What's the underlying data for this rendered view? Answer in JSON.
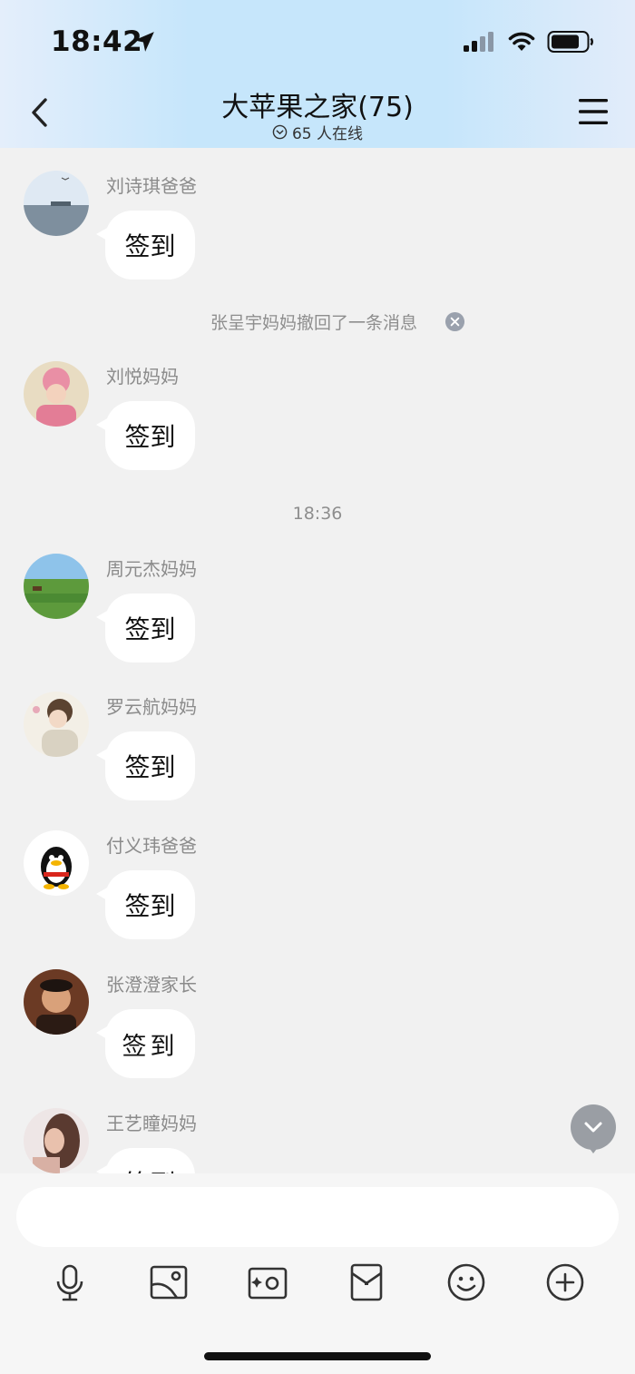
{
  "status_bar": {
    "time": "18:42"
  },
  "header": {
    "title": "大苹果之家(75)",
    "online": "65 人在线"
  },
  "messages": [
    {
      "sender": "刘诗琪爸爸",
      "text": "签到"
    },
    {
      "sender": "刘悦妈妈",
      "text": "签到"
    },
    {
      "sender": "周元杰妈妈",
      "text": "签到"
    },
    {
      "sender": "罗云航妈妈",
      "text": "签到"
    },
    {
      "sender": "付义玮爸爸",
      "text": "签到"
    },
    {
      "sender": "张澄澄家长",
      "text": "签到"
    },
    {
      "sender": "王艺瞳妈妈",
      "text": "签到"
    }
  ],
  "system": {
    "recall_notice": "张呈宇妈妈撤回了一条消息",
    "timestamp": "18:36"
  },
  "input": {
    "placeholder": ""
  },
  "toolbar": [
    "microphone-icon",
    "image-icon",
    "camera-icon",
    "red-packet-icon",
    "emoji-icon",
    "plus-icon"
  ],
  "colors": {
    "header_gradient": "#c6e6fb",
    "background": "#f1f1f1",
    "bubble": "#ffffff",
    "scroll_button": "#9a9ea4"
  }
}
